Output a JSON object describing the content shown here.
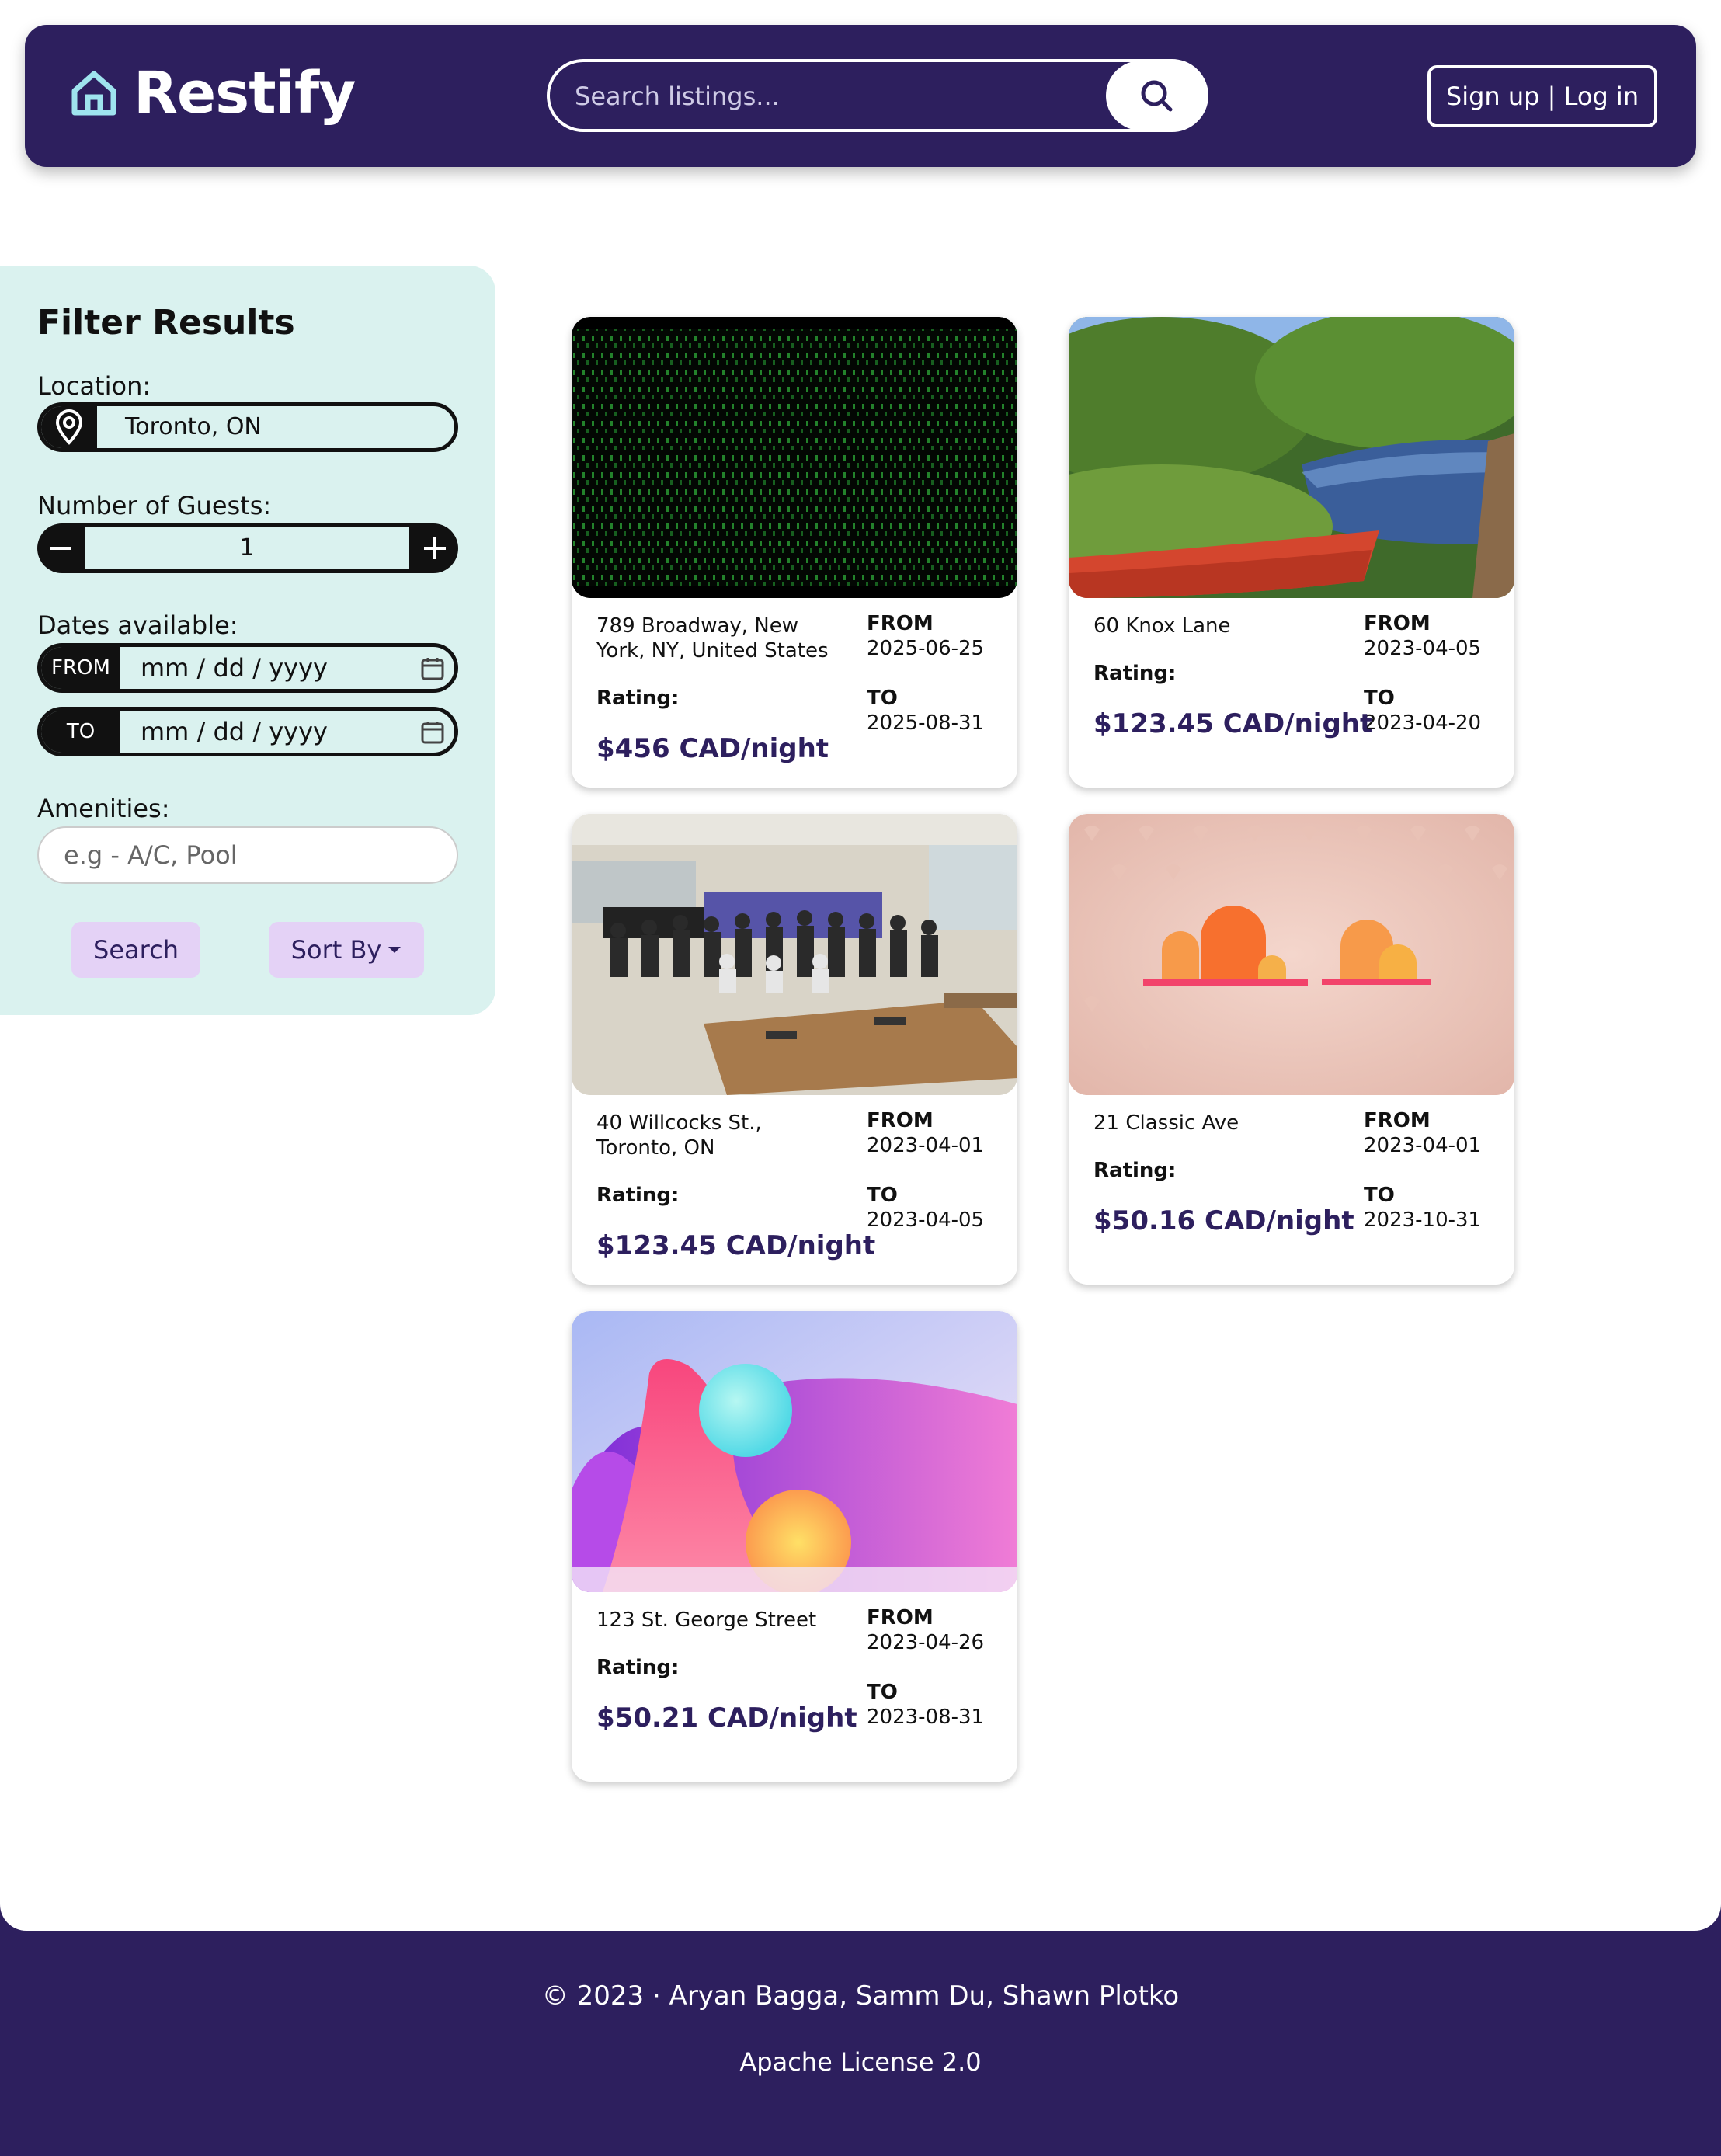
{
  "header": {
    "brand": "Restify",
    "search_placeholder": "Search listings...",
    "auth_label": "Sign up | Log in"
  },
  "filters": {
    "title": "Filter Results",
    "location_label": "Location:",
    "location_value": "Toronto, ON",
    "guests_label": "Number of Guests:",
    "guests_value": "1",
    "dates_label": "Dates available:",
    "from_tag": "FROM",
    "to_tag": "TO",
    "date_placeholder": "mm / dd / yyyy",
    "amenities_label": "Amenities:",
    "amenities_placeholder": "e.g - A/C, Pool",
    "search_label": "Search",
    "sort_label": "Sort By"
  },
  "listing_labels": {
    "from": "FROM",
    "to": "TO",
    "rating": "Rating:"
  },
  "listings": [
    {
      "address": "789 Broadway, New York, NY, United States",
      "from": "2025-06-25",
      "to": "2025-08-31",
      "price": "$456 CAD/night",
      "image": "matrix-code-image"
    },
    {
      "address": "60 Knox Lane",
      "from": "2023-04-05",
      "to": "2023-04-20",
      "price": "$123.45 CAD/night",
      "image": "kayak-river-image"
    },
    {
      "address": "40 Willcocks St., Toronto, ON",
      "from": "2023-04-01",
      "to": "2023-04-05",
      "price": "$123.45 CAD/night",
      "image": "group-photo-image"
    },
    {
      "address": "21 Classic Ave",
      "from": "2023-04-01",
      "to": "2023-10-31",
      "price": "$50.16 CAD/night",
      "image": "shelves-wallpaper-image"
    },
    {
      "address": "123 St. George Street",
      "from": "2023-04-26",
      "to": "2023-08-31",
      "price": "$50.21 CAD/night",
      "image": "abstract-wallpaper-image"
    }
  ],
  "footer": {
    "copyright": "© 2023 · Aryan Bagga, Samm Du, Shawn Plotko",
    "license": "Apache License 2.0"
  },
  "colors": {
    "brand": "#2d1f5e",
    "sidebar": "#daf2ef",
    "button": "#e4d2f6",
    "logo": "#9fe3ee"
  }
}
